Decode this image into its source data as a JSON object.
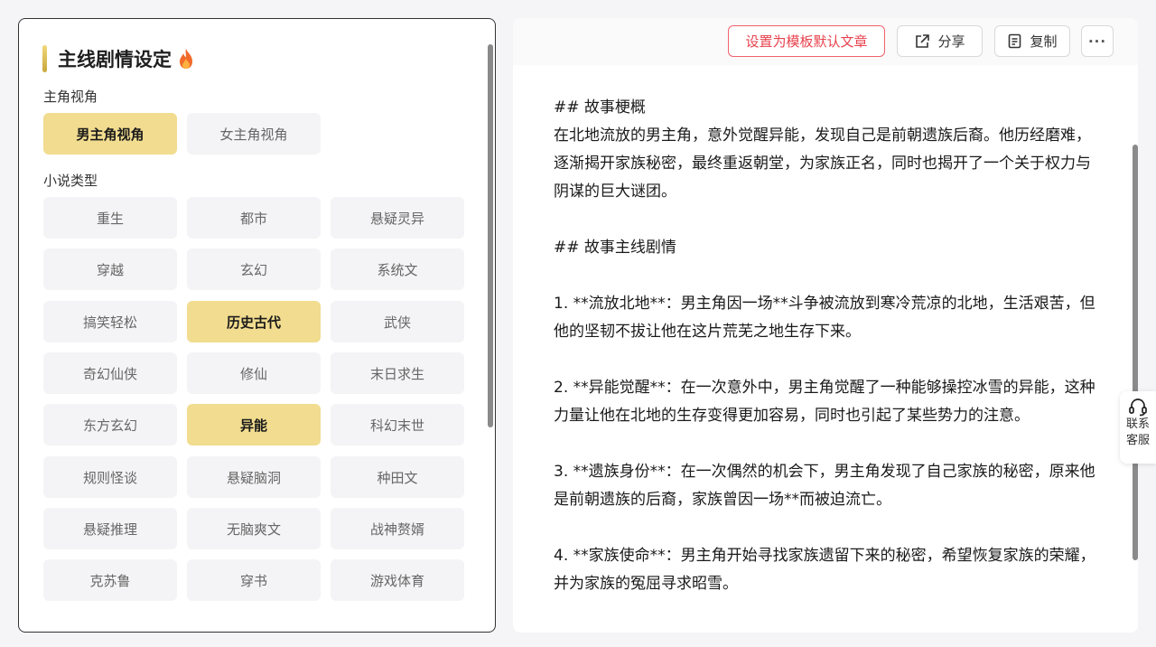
{
  "left": {
    "title": "主线剧情设定",
    "pov_label": "主角视角",
    "pov_options": [
      {
        "label": "男主角视角",
        "selected": true
      },
      {
        "label": "女主角视角",
        "selected": false
      }
    ],
    "genre_label": "小说类型",
    "genres": [
      {
        "label": "重生",
        "selected": false
      },
      {
        "label": "都市",
        "selected": false
      },
      {
        "label": "悬疑灵异",
        "selected": false
      },
      {
        "label": "穿越",
        "selected": false
      },
      {
        "label": "玄幻",
        "selected": false
      },
      {
        "label": "系统文",
        "selected": false
      },
      {
        "label": "搞笑轻松",
        "selected": false
      },
      {
        "label": "历史古代",
        "selected": true
      },
      {
        "label": "武侠",
        "selected": false
      },
      {
        "label": "奇幻仙侠",
        "selected": false
      },
      {
        "label": "修仙",
        "selected": false
      },
      {
        "label": "末日求生",
        "selected": false
      },
      {
        "label": "东方玄幻",
        "selected": false
      },
      {
        "label": "异能",
        "selected": true
      },
      {
        "label": "科幻末世",
        "selected": false
      },
      {
        "label": "规则怪谈",
        "selected": false
      },
      {
        "label": "悬疑脑洞",
        "selected": false
      },
      {
        "label": "种田文",
        "selected": false
      },
      {
        "label": "悬疑推理",
        "selected": false
      },
      {
        "label": "无脑爽文",
        "selected": false
      },
      {
        "label": "战神赘婿",
        "selected": false
      },
      {
        "label": "克苏鲁",
        "selected": false
      },
      {
        "label": "穿书",
        "selected": false
      },
      {
        "label": "游戏体育",
        "selected": false
      }
    ]
  },
  "toolbar": {
    "set_default_label": "设置为模板默认文章",
    "share_label": "分享",
    "copy_label": "复制",
    "more_label": "···"
  },
  "article": {
    "paragraphs": [
      "## 故事梗概\n在北地流放的男主角，意外觉醒异能，发现自己是前朝遗族后裔。他历经磨难，逐渐揭开家族秘密，最终重返朝堂，为家族正名，同时也揭开了一个关于权力与阴谋的巨大谜团。",
      "## 故事主线剧情",
      "1. **流放北地**：男主角因一场**斗争被流放到寒冷荒凉的北地，生活艰苦，但他的坚韧不拔让他在这片荒芜之地生存下来。",
      "2. **异能觉醒**：在一次意外中，男主角觉醒了一种能够操控冰雪的异能，这种力量让他在北地的生存变得更加容易，同时也引起了某些势力的注意。",
      "3. **遗族身份**：在一次偶然的机会下，男主角发现了自己家族的秘密，原来他是前朝遗族的后裔，家族曾因一场**而被迫流亡。",
      "4. **家族使命**：男主角开始寻找家族遗留下来的秘密，希望恢复家族的荣耀，并为家族的冤屈寻求昭雪。"
    ]
  },
  "support": {
    "line1": "联系",
    "line2": "客服"
  },
  "colors": {
    "selected_chip": "#f1dc8f",
    "chip": "#f4f4f6",
    "accent_red": "#e8424d"
  }
}
